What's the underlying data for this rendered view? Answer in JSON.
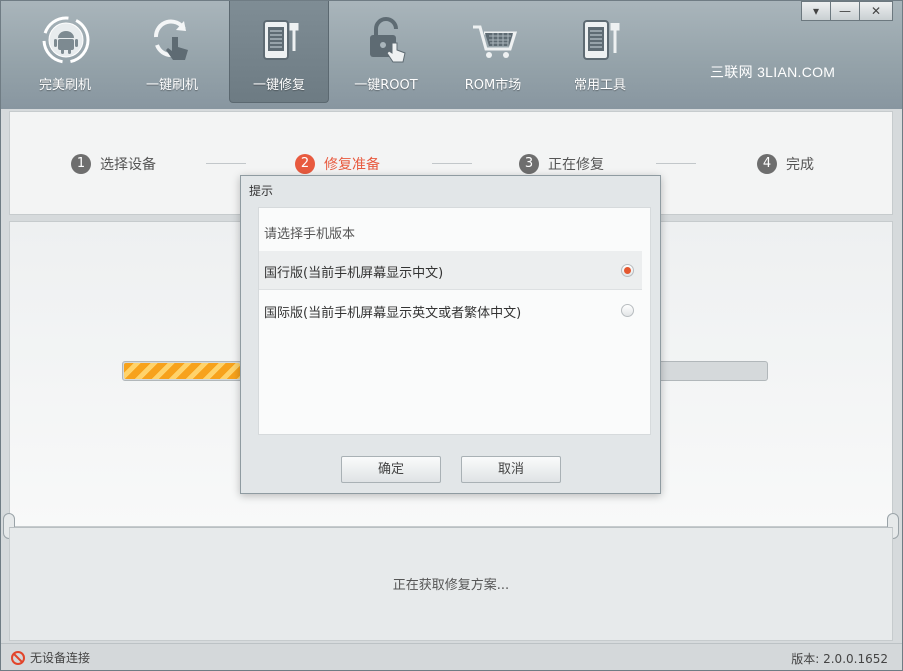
{
  "header": {
    "nav": [
      {
        "label": "完美刷机",
        "icon": "android-icon"
      },
      {
        "label": "一键刷机",
        "icon": "refresh-touch-icon"
      },
      {
        "label": "一键修复",
        "icon": "phone-wrench-icon",
        "active": true
      },
      {
        "label": "一键ROOT",
        "icon": "unlock-icon"
      },
      {
        "label": "ROM市场",
        "icon": "shopping-cart-icon"
      },
      {
        "label": "常用工具",
        "icon": "toolbox-icon"
      }
    ],
    "brand": "三联网 3LIAN.COM",
    "window_controls": {
      "menu": "▾",
      "minimize": "—",
      "close": "✕"
    }
  },
  "steps": [
    {
      "num": "1",
      "label": "选择设备"
    },
    {
      "num": "2",
      "label": "修复准备",
      "active": true
    },
    {
      "num": "3",
      "label": "正在修复"
    },
    {
      "num": "4",
      "label": "完成"
    }
  ],
  "progress": {
    "value": 0.18
  },
  "status_message": "正在获取修复方案...",
  "statusbar": {
    "connection": "无设备连接",
    "version": "版本: 2.0.0.1652"
  },
  "dialog": {
    "title": "提示",
    "prompt": "请选择手机版本",
    "options": [
      {
        "label": "国行版(当前手机屏幕显示中文)",
        "selected": true
      },
      {
        "label": "国际版(当前手机屏幕显示英文或者繁体中文)",
        "selected": false
      }
    ],
    "ok_label": "确定",
    "cancel_label": "取消"
  },
  "colors": {
    "accent": "#e85a3f",
    "progress": "#f7a21c",
    "header": "#94a2a9"
  }
}
